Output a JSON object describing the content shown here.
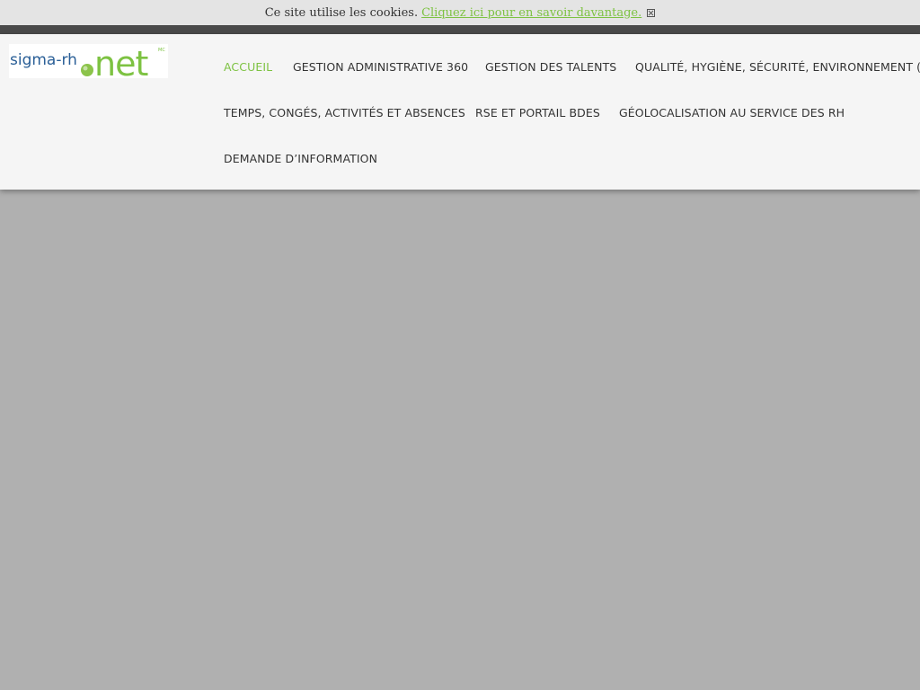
{
  "cookie_bar": {
    "message": "Ce site utilise les cookies.",
    "link_text": "Cliquez ici pour en savoir davantage.",
    "link_color": "#7dc242"
  },
  "logo": {
    "text_sigma": "sigma-rh",
    "text_net": "net",
    "mark": "MC"
  },
  "nav": {
    "active_color": "#7dc242",
    "items": [
      {
        "label": "ACCUEIL",
        "active": true
      },
      {
        "label": "GESTION ADMINISTRATIVE 360"
      },
      {
        "label": "GESTION DES TALENTS"
      },
      {
        "label": "QUALITÉ, HYGIÈNE, SÉCURITÉ, ENVIRONNEMENT (QHSE)"
      },
      {
        "label": "TEMPS, CONGÉS, ACTIVITÉS ET ABSENCES"
      },
      {
        "label": "RSE ET PORTAIL BDES"
      },
      {
        "label": "GÉOLOCALISATION AU SERVICE DES RH"
      },
      {
        "label": "DEMANDE D’INFORMATION"
      }
    ]
  }
}
